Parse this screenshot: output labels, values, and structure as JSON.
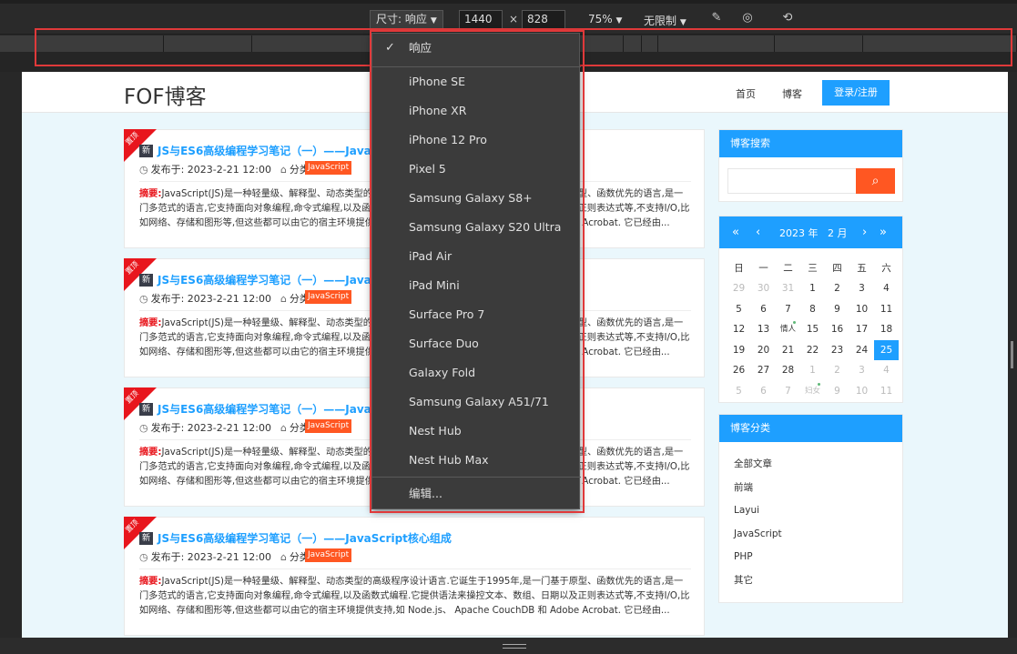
{
  "toolbar": {
    "dimension_label": "尺寸: 响应",
    "width": "1440",
    "times": "×",
    "height": "828",
    "zoom": "75%",
    "throttle": "无限制"
  },
  "dropdown": {
    "selected": "响应",
    "items": [
      "iPhone SE",
      "iPhone XR",
      "iPhone 12 Pro",
      "Pixel 5",
      "Samsung Galaxy S8+",
      "Samsung Galaxy S20 Ultra",
      "iPad Air",
      "iPad Mini",
      "Surface Pro 7",
      "Surface Duo",
      "Galaxy Fold",
      "Samsung Galaxy A51/71",
      "Nest Hub",
      "Nest Hub Max"
    ],
    "edit": "编辑..."
  },
  "site": {
    "logo": "FOF博客",
    "nav_home": "首页",
    "nav_blog": "博客",
    "login": "登录/注册"
  },
  "post": {
    "ribbon": "置顶",
    "new": "新",
    "title": "JS与ES6高级编程学习笔记（一）——JavaScript核心组成",
    "title_short": "JS与ES6高级编程学习笔记（一）——Java",
    "date": "发布于: 2023-2-21 12:00",
    "category_label": "分类:",
    "category": "JavaScript",
    "excerpt_label": "摘要:",
    "excerpt": "JavaScript(JS)是一种轻量级、解释型、动态类型的高级程序设计语言.它诞生于1995年,是一门基于原型、函数优先的语言,是一门多范式的语言,它支持面向对象编程,命令式编程,以及函数式编程.它提供语法来操控文本、数组、日期以及正则表达式等,不支持I/O,比如网络、存储和图形等,但这些都可以由它的宿主环境提供支持,如 Node.js、 Apache CouchDB 和 Adobe Acrobat. 它已经由..."
  },
  "sidebar": {
    "search_title": "博客搜索",
    "calendar": {
      "year": "2023 年",
      "month": "2 月",
      "weekdays": [
        "日",
        "一",
        "二",
        "三",
        "四",
        "五",
        "六"
      ],
      "rows": [
        [
          "29",
          "30",
          "31",
          "1",
          "2",
          "3",
          "4"
        ],
        [
          "5",
          "6",
          "7",
          "8",
          "9",
          "10",
          "11"
        ],
        [
          "12",
          "13",
          "情人",
          "15",
          "16",
          "17",
          "18"
        ],
        [
          "19",
          "20",
          "21",
          "22",
          "23",
          "24",
          "25"
        ],
        [
          "26",
          "27",
          "28",
          "1",
          "2",
          "3",
          "4"
        ],
        [
          "5",
          "6",
          "7",
          "妇女",
          "9",
          "10",
          "11"
        ]
      ]
    },
    "category_title": "博客分类",
    "categories": [
      "全部文章",
      "前端",
      "Layui",
      "JavaScript",
      "PHP",
      "其它"
    ]
  },
  "colors": {
    "accent": "#1e9fff",
    "orange": "#ff5722",
    "red": "#e8161d"
  }
}
